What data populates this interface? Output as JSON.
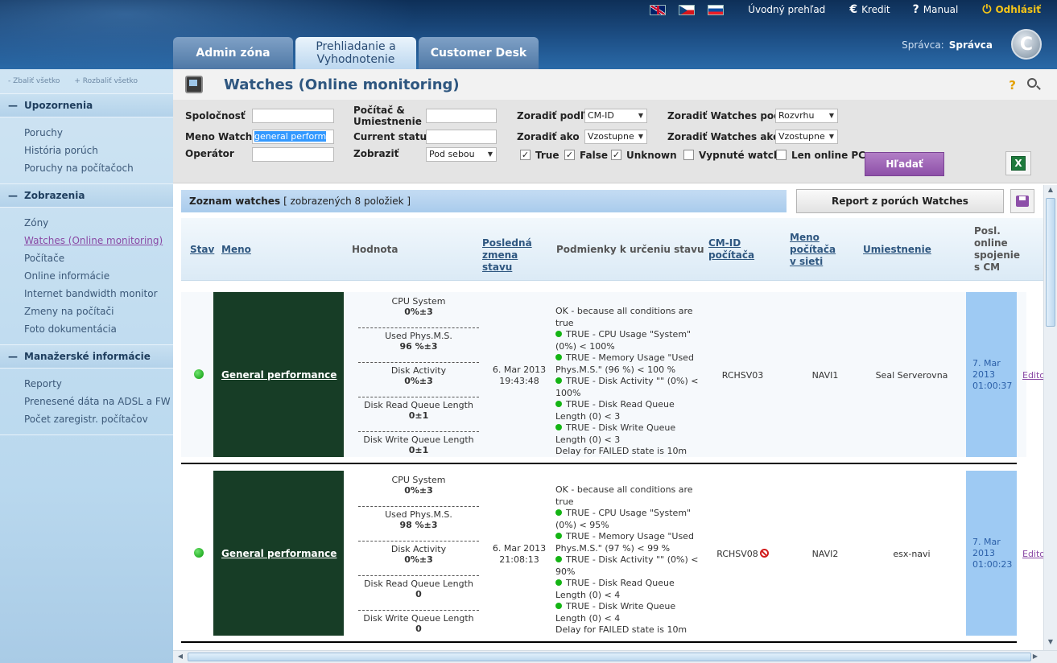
{
  "header": {
    "languages": [
      {
        "code": "en",
        "flag": "uk-flag-icon"
      },
      {
        "code": "cz",
        "flag": "cz-flag-icon"
      },
      {
        "code": "sk",
        "flag": "sk-flag-icon"
      }
    ],
    "nav": {
      "overview": "Úvodný prehľad",
      "credit": "Kredit",
      "manual": "Manual",
      "logout": "Odhlásiť"
    },
    "admin_label": "Správca:",
    "admin_name": "Správca",
    "logo_letter": "C",
    "tabs": [
      {
        "label": "Admin zóna"
      },
      {
        "label": "Prehliadanie a Vyhodnotenie"
      },
      {
        "label": "Customer Desk"
      }
    ]
  },
  "sidebar": {
    "collapse_all": "- Zbaliť všetko",
    "expand_all": "+ Rozbaliť všetko",
    "sections": [
      {
        "title": "Upozornenia",
        "items": [
          "Poruchy",
          "História porúch",
          "Poruchy na počítačoch"
        ]
      },
      {
        "title": "Zobrazenia",
        "items": [
          "Zóny",
          "Watches (Online monitoring)",
          "Počítače",
          "Online informácie",
          "Internet bandwidth monitor",
          "Zmeny na počítači",
          "Foto dokumentácia"
        ]
      },
      {
        "title": "Manažerské informácie",
        "items": [
          "Reporty",
          "Prenesené dáta na ADSL a FW",
          "Počet zaregistr. počítačov"
        ]
      }
    ]
  },
  "page": {
    "title": "Watches (Online monitoring)"
  },
  "filters": {
    "company_label": "Spoločnosť",
    "company_value": "",
    "watch_name_label": "Meno Watchu",
    "watch_name_value": "general perform",
    "operator_label": "Operátor",
    "operator_value": "",
    "pc_label": "Počítač & Umiestnenie",
    "pc_value": "",
    "status_label": "Current status",
    "status_value": "",
    "show_label": "Zobraziť",
    "show_value": "Pod sebou",
    "sort_by_label": "Zoradiť podľa",
    "sort_by_value": "CM-ID",
    "sort_as_label": "Zoradiť ako",
    "sort_as_value": "Vzostupne",
    "sort_watches_by_label": "Zoradiť Watches podľa",
    "sort_watches_by_value": "Rozvrhu",
    "sort_watches_as_label": "Zoradiť Watches ako",
    "sort_watches_as_value": "Vzostupne",
    "checkboxes": [
      {
        "label": "True",
        "checked": true
      },
      {
        "label": "False",
        "checked": true
      },
      {
        "label": "Unknown",
        "checked": true
      },
      {
        "label": "Vypnuté watche",
        "checked": false
      },
      {
        "label": "Len online PC",
        "checked": false
      }
    ],
    "search_button": "Hľadať",
    "excel_icon": "X"
  },
  "list": {
    "title": "Zoznam watches",
    "count_text": "[ zobrazených 8 položiek ]",
    "report_button": "Report z porúch Watches",
    "columns": {
      "status": "Stav",
      "name": "Meno",
      "value": "Hodnota",
      "last_change": "Posledná zmena stavu",
      "conditions": "Podmienky k určeniu stavu",
      "cmid": "CM-ID počítača",
      "pc_name": "Meno počítača v sieti",
      "location": "Umiestnenie",
      "last_online": "Posl. online spojenie s CM"
    },
    "rows": [
      {
        "name": "General performance",
        "values": [
          {
            "label": "CPU System",
            "value": "0%±3"
          },
          {
            "label": "Used Phys.M.S.",
            "value": "96 %±3"
          },
          {
            "label": "Disk Activity",
            "value": "0%±3"
          },
          {
            "label": "Disk Read Queue Length",
            "value": "0±1"
          },
          {
            "label": "Disk Write Queue Length",
            "value": "0±1"
          }
        ],
        "last_change_date": "6. Mar 2013",
        "last_change_time": "19:43:48",
        "cond_intro": "OK - because all conditions are true",
        "conditions": [
          "TRUE - CPU Usage \"System\" (0%) < 100%",
          "TRUE - Memory Usage \"Used Phys.M.S.\" (96 %) < 100 %",
          "TRUE - Disk Activity \"\" (0%) < 100%",
          "TRUE - Disk Read Queue Length (0) < 3",
          "TRUE - Disk Write Queue Length (0) < 3"
        ],
        "cond_delay": "Delay for FAILED state is 10m",
        "cmid": "RCHSV03",
        "pc_name": "NAVI1",
        "location": "Seal Serverovna",
        "last_online_date": "7. Mar 2013",
        "last_online_time": "01:00:37",
        "edit": "Editovať"
      },
      {
        "name": "General performance",
        "values": [
          {
            "label": "CPU System",
            "value": "0%±3"
          },
          {
            "label": "Used Phys.M.S.",
            "value": "98 %±3"
          },
          {
            "label": "Disk Activity",
            "value": "0%±3"
          },
          {
            "label": "Disk Read Queue Length",
            "value": "0"
          },
          {
            "label": "Disk Write Queue Length",
            "value": "0"
          }
        ],
        "last_change_date": "6. Mar 2013",
        "last_change_time": "21:08:13",
        "cond_intro": "OK - because all conditions are true",
        "conditions": [
          "TRUE - CPU Usage \"System\" (0%) < 95%",
          "TRUE - Memory Usage \"Used Phys.M.S.\" (97 %) < 99 %",
          "TRUE - Disk Activity \"\" (0%) < 90%",
          "TRUE - Disk Read Queue Length (0) < 4",
          "TRUE - Disk Write Queue Length (0) < 4"
        ],
        "cond_delay": "Delay for FAILED state is 10m",
        "cmid": "RCHSV08",
        "pc_name": "NAVI2",
        "location": "esx-navi",
        "last_online_date": "7. Mar 2013",
        "last_online_time": "01:00:23",
        "edit": "Editovať"
      }
    ]
  }
}
